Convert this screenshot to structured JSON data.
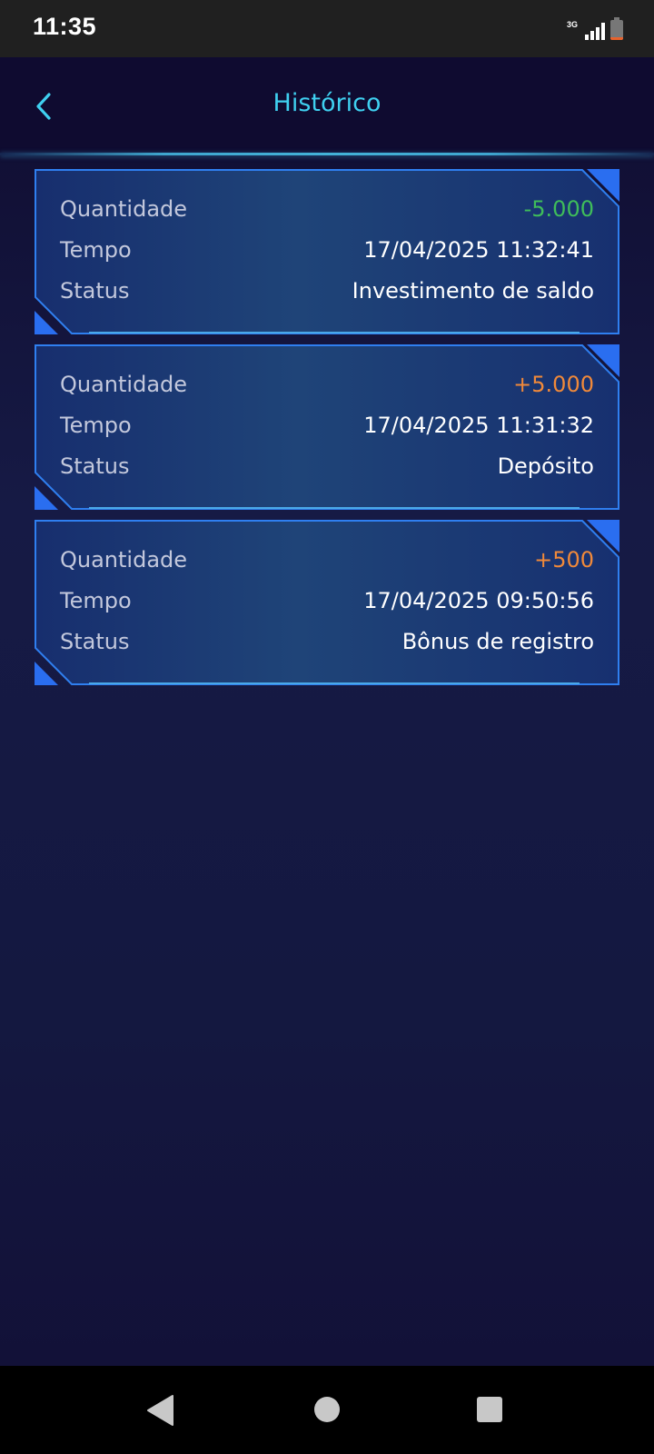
{
  "status_bar": {
    "time": "11:35",
    "network": "3G",
    "icons": [
      "signal-icon",
      "battery-icon"
    ]
  },
  "header": {
    "title": "Histórico",
    "back_icon": "chevron-left-icon"
  },
  "labels": {
    "amount": "Quantidade",
    "time": "Tempo",
    "status": "Status"
  },
  "records": [
    {
      "amount": "-5.000",
      "amount_color": "#3fbd5a",
      "time": "17/04/2025 11:32:41",
      "status": "Investimento de saldo"
    },
    {
      "amount": "+5.000",
      "amount_color": "#f0893a",
      "time": "17/04/2025 11:31:32",
      "status": "Depósito"
    },
    {
      "amount": "+500",
      "amount_color": "#f0893a",
      "time": "17/04/2025 09:50:56",
      "status": "Bônus de registro"
    }
  ],
  "colors": {
    "accent": "#3fd0f0",
    "card_border": "#2f7ff0",
    "background": "#151a45"
  },
  "nav_bar": {
    "icons": [
      "back-triangle-icon",
      "home-circle-icon",
      "recents-square-icon"
    ]
  }
}
